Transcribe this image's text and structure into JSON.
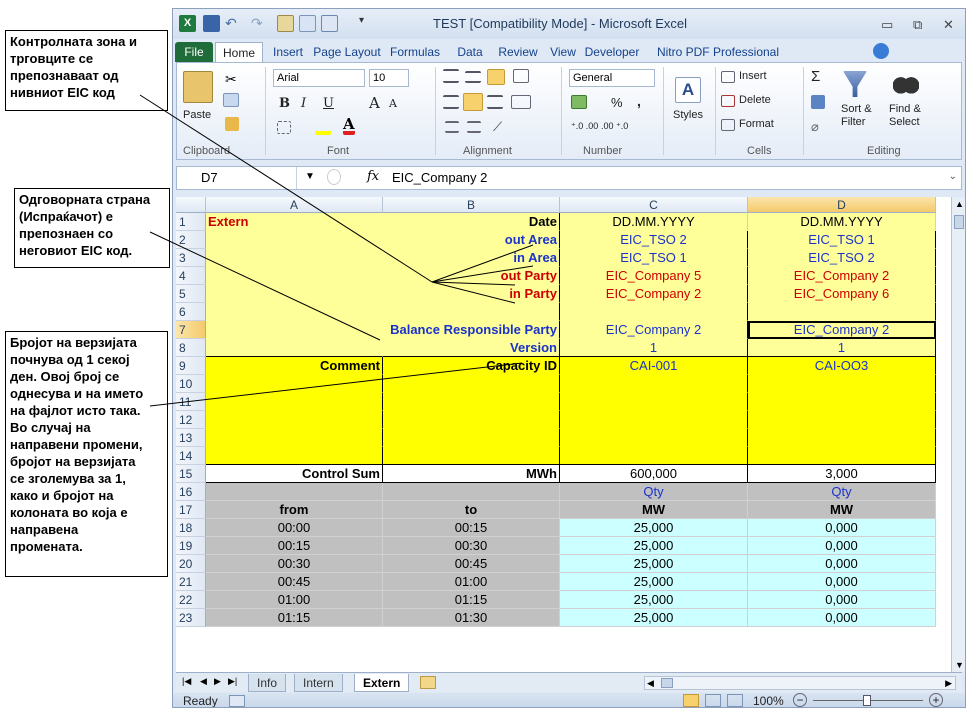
{
  "annotations": {
    "a1": "Контролната зона и\nтрговците се\nпрепознаваат од\nнивниот EIC код",
    "a2": "Одговорната страна\n(Испраќачот) е\nпрепознаен со\nнеговиот EIC код.",
    "a3": "Бројот на верзијата\nпочнува од 1 секој\nден. Овој број се\nоднесува и на името\nна фајлот исто така.\nВо случај на\nнаправени промени,\nбројот на верзијата\nсе зголемува за 1,\nкако и бројот на\nколоната во која е\nнаправена\nпромената."
  },
  "window": {
    "title": "TEST  [Compatibility Mode]  -  Microsoft Excel",
    "min": "▭",
    "max": "⧉",
    "close": "✕"
  },
  "tabs": [
    "File",
    "Home",
    "Insert",
    "Page Layout",
    "Formulas",
    "Data",
    "Review",
    "View",
    "Developer",
    "Nitro PDF Professional"
  ],
  "ribbon": {
    "clipboard": {
      "label": "Clipboard",
      "paste": "Paste"
    },
    "font": {
      "label": "Font",
      "name": "Arial",
      "size": "10",
      "bold": "B",
      "italic": "I",
      "underline": "U",
      "grow": "A",
      "shrink": "A"
    },
    "alignment": {
      "label": "Alignment"
    },
    "number": {
      "label": "Number",
      "format": "General",
      "percent": "%",
      "comma": ",",
      "inc": "⁺.0 .00",
      "dec": ".00 ⁺.0"
    },
    "styles": {
      "label": "Styles"
    },
    "cells": {
      "label": "Cells",
      "insert": "Insert",
      "delete": "Delete",
      "format": "Format"
    },
    "editing": {
      "label": "Editing",
      "sigma": "Σ",
      "sort": "Sort &\nFilter",
      "find": "Find &\nSelect"
    }
  },
  "formula_bar": {
    "name_box": "D7",
    "fx": "fx",
    "value": "EIC_Company 2"
  },
  "columns": [
    "A",
    "B",
    "C",
    "D"
  ],
  "rows": [
    {
      "n": "1",
      "A": "Extern",
      "B": "Date",
      "C": "DD.MM.YYYY",
      "D": "DD.MM.YYYY"
    },
    {
      "n": "2",
      "A": "",
      "B": "out Area",
      "C": "EIC_TSO 2",
      "D": "EIC_TSO 1"
    },
    {
      "n": "3",
      "A": "",
      "B": "in Area",
      "C": "EIC_TSO 1",
      "D": "EIC_TSO 2"
    },
    {
      "n": "4",
      "A": "",
      "B": "out Party",
      "C": "EIC_Company 5",
      "D": "EIC_Company 2"
    },
    {
      "n": "5",
      "A": "",
      "B": "in Party",
      "C": "EIC_Company 2",
      "D": "EIC_Company 6"
    },
    {
      "n": "6",
      "A": "",
      "B": "",
      "C": "",
      "D": ""
    },
    {
      "n": "7",
      "A": "",
      "B": "Balance Responsible Party",
      "C": "EIC_Company 2",
      "D": "EIC_Company 2"
    },
    {
      "n": "8",
      "A": "",
      "B": "Version",
      "C": "1",
      "D": "1"
    },
    {
      "n": "9",
      "A": "Comment",
      "B": "Capacity ID",
      "C": "CAI-001",
      "D": "CAI-OO3"
    },
    {
      "n": "10",
      "A": "",
      "B": "",
      "C": "",
      "D": ""
    },
    {
      "n": "11",
      "A": "",
      "B": "",
      "C": "",
      "D": ""
    },
    {
      "n": "12",
      "A": "",
      "B": "",
      "C": "",
      "D": ""
    },
    {
      "n": "13",
      "A": "",
      "B": "",
      "C": "",
      "D": ""
    },
    {
      "n": "14",
      "A": "",
      "B": "",
      "C": "",
      "D": ""
    },
    {
      "n": "15",
      "A": "Control Sum",
      "B": "MWh",
      "C": "600,000",
      "D": "3,000"
    },
    {
      "n": "16",
      "A": "",
      "B": "",
      "C": "Qty",
      "D": "Qty"
    },
    {
      "n": "17",
      "A": "from",
      "B": "to",
      "C": "MW",
      "D": "MW"
    },
    {
      "n": "18",
      "A": "00:00",
      "B": "00:15",
      "C": "25,000",
      "D": "0,000"
    },
    {
      "n": "19",
      "A": "00:15",
      "B": "00:30",
      "C": "25,000",
      "D": "0,000"
    },
    {
      "n": "20",
      "A": "00:30",
      "B": "00:45",
      "C": "25,000",
      "D": "0,000"
    },
    {
      "n": "21",
      "A": "00:45",
      "B": "01:00",
      "C": "25,000",
      "D": "0,000"
    },
    {
      "n": "22",
      "A": "01:00",
      "B": "01:15",
      "C": "25,000",
      "D": "0,000"
    },
    {
      "n": "23",
      "A": "01:15",
      "B": "01:30",
      "C": "25,000",
      "D": "0,000"
    }
  ],
  "sheet_tabs": [
    "Info",
    "Intern",
    "Extern"
  ],
  "status": {
    "ready": "Ready",
    "zoom": "100%"
  },
  "colors": {
    "yellow_light": "#ffff99",
    "yellow": "#ffff00",
    "gray": "#c0c0c0",
    "cyan": "#ccffff",
    "red": "#cc0000",
    "blue": "#1a33cc",
    "selection": "#f5c96b"
  }
}
